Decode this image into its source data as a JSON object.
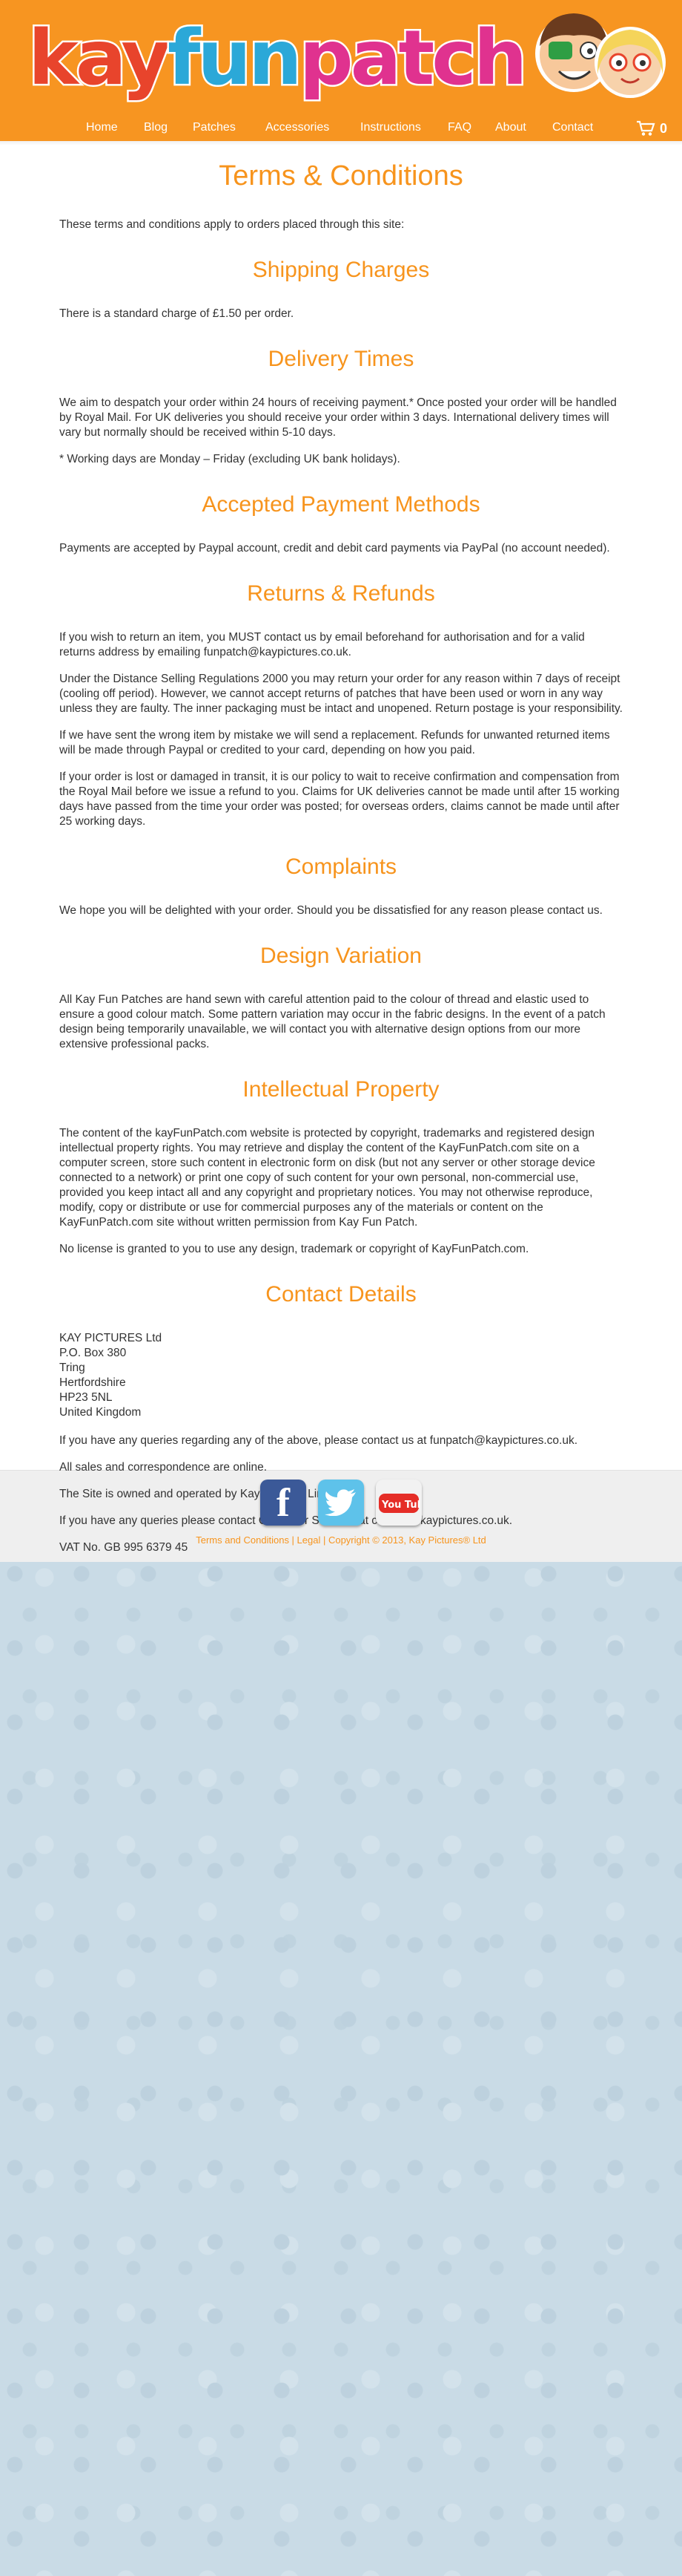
{
  "header": {
    "logo": {
      "part1": "kay",
      "part2": "fun",
      "part3": "patch"
    },
    "nav": [
      "Home",
      "Blog",
      "Patches",
      "Accessories",
      "Instructions",
      "FAQ",
      "About",
      "Contact"
    ],
    "cart_count": "0"
  },
  "page": {
    "title": "Terms & Conditions",
    "intro": "These terms and conditions apply to orders placed through this site:",
    "sections": [
      {
        "heading": "Shipping Charges",
        "paragraphs": [
          "There is a standard charge of £1.50 per order."
        ]
      },
      {
        "heading": "Delivery Times",
        "paragraphs": [
          "We aim to despatch your order within 24 hours of receiving payment.* Once posted your order will be handled by Royal Mail. For UK deliveries you should receive your order within 3 days. International delivery times will vary but normally should be received within 5-10 days.",
          "* Working days are Monday – Friday (excluding UK bank holidays)."
        ]
      },
      {
        "heading": "Accepted Payment Methods",
        "paragraphs": [
          "Payments are accepted by Paypal account, credit and debit card payments via PayPal (no account needed)."
        ]
      },
      {
        "heading": "Returns & Refunds",
        "paragraphs": [
          "If you wish to return an item, you MUST contact us by email beforehand for authorisation and for a valid returns address by emailing funpatch@kaypictures.co.uk.",
          "Under the Distance Selling Regulations 2000 you may return your order for any reason within 7 days of receipt (cooling off period). However, we cannot accept returns of patches that have been used or worn in any way unless they are faulty. The inner packaging must be intact and unopened. Return postage is your responsibility.",
          "If we have sent the wrong item by mistake we will send a replacement. Refunds for unwanted returned items will be made through Paypal or credited to your card, depending on how you paid.",
          "If your order is lost or damaged in transit, it is our policy to wait to receive confirmation and compensation from the Royal Mail before we issue a refund to you. Claims for UK deliveries cannot be made until after 15 working days have passed from the time your order was posted; for overseas orders, claims cannot be made until after 25 working days."
        ]
      },
      {
        "heading": "Complaints",
        "paragraphs": [
          "We hope you will be delighted with your order. Should you be dissatisfied for any reason please contact us."
        ]
      },
      {
        "heading": "Design Variation",
        "paragraphs": [
          "All Kay Fun Patches are hand sewn with careful attention paid to the colour of thread and elastic used to ensure a good colour match. Some pattern variation may occur in the fabric designs. In the event of a patch design being temporarily unavailable, we will contact you with alternative design options from our more extensive professional packs."
        ]
      },
      {
        "heading": "Intellectual Property",
        "paragraphs": [
          "The content of the kayFunPatch.com website is protected by copyright, trademarks and registered design intellectual property rights. You may retrieve and display the content of the KayFunPatch.com site on a computer screen, store such content in electronic form on disk (but not any server or other storage device connected to a network) or print one copy of such content for your own personal, non-commercial use, provided you keep intact all and any copyright and proprietary notices. You may not otherwise reproduce, modify, copy or distribute or use for commercial purposes any of the materials or content on the KayFunPatch.com site without written permission from Kay Fun Patch.",
          "No license is granted to you to use any design, trademark or copyright of KayFunPatch.com."
        ]
      }
    ],
    "contact": {
      "heading": "Contact Details",
      "address": [
        "KAY PICTURES Ltd",
        "P.O. Box 380",
        "Tring",
        "Hertfordshire",
        "HP23 5NL",
        "United Kingdom"
      ],
      "paragraphs": [
        "If you have any queries regarding any of the above, please contact us at funpatch@kaypictures.co.uk.",
        "All sales and correspondence are online.",
        "The Site is owned and operated by Kay Pictures Limited.",
        "If you have any queries please contact Customer Services at contact@kaypictures.co.uk.",
        "VAT No. GB 995 6379 45"
      ]
    }
  },
  "footer": {
    "social": [
      "facebook",
      "twitter",
      "youtube"
    ],
    "youtube_label": "You Tube",
    "links": "Terms and Conditions | Legal | Copyright © 2013, Kay Pictures® Ltd"
  },
  "colors": {
    "accent": "#f7941d",
    "header_bg": "#f79521",
    "kay": "#e8442c",
    "fun": "#2ba8d8",
    "patch": "#e0328f"
  }
}
